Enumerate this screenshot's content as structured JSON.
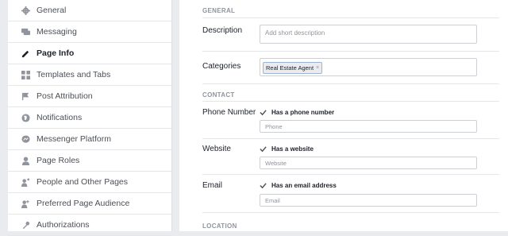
{
  "sidebar": {
    "items": [
      {
        "label": "General",
        "icon": "gear-icon"
      },
      {
        "label": "Messaging",
        "icon": "chat-bubble-icon"
      },
      {
        "label": "Page Info",
        "icon": "pencil-icon",
        "active": true
      },
      {
        "label": "Templates and Tabs",
        "icon": "grid-icon"
      },
      {
        "label": "Post Attribution",
        "icon": "flag-icon"
      },
      {
        "label": "Notifications",
        "icon": "globe-icon"
      },
      {
        "label": "Messenger Platform",
        "icon": "messenger-icon"
      },
      {
        "label": "Page Roles",
        "icon": "person-icon"
      },
      {
        "label": "People and Other Pages",
        "icon": "people-icon"
      },
      {
        "label": "Preferred Page Audience",
        "icon": "audience-icon"
      },
      {
        "label": "Authorizations",
        "icon": "wrench-icon"
      }
    ]
  },
  "main": {
    "general_heading": "GENERAL",
    "description": {
      "label": "Description",
      "placeholder": "Add short description"
    },
    "categories": {
      "label": "Categories",
      "tag": "Real Estate Agent",
      "remove": "×"
    },
    "contact_heading": "CONTACT",
    "phone": {
      "label": "Phone Number",
      "checkbox_label": "Has a phone number",
      "placeholder": "Phone"
    },
    "website": {
      "label": "Website",
      "checkbox_label": "Has a website",
      "placeholder": "Website"
    },
    "email": {
      "label": "Email",
      "checkbox_label": "Has an email address",
      "placeholder": "Email"
    },
    "location_heading": "LOCATION"
  },
  "colors": {
    "background": "#e9ebee",
    "text_primary": "#1d2129",
    "text_secondary": "#90949c",
    "tag_border": "#9cb4d8"
  }
}
